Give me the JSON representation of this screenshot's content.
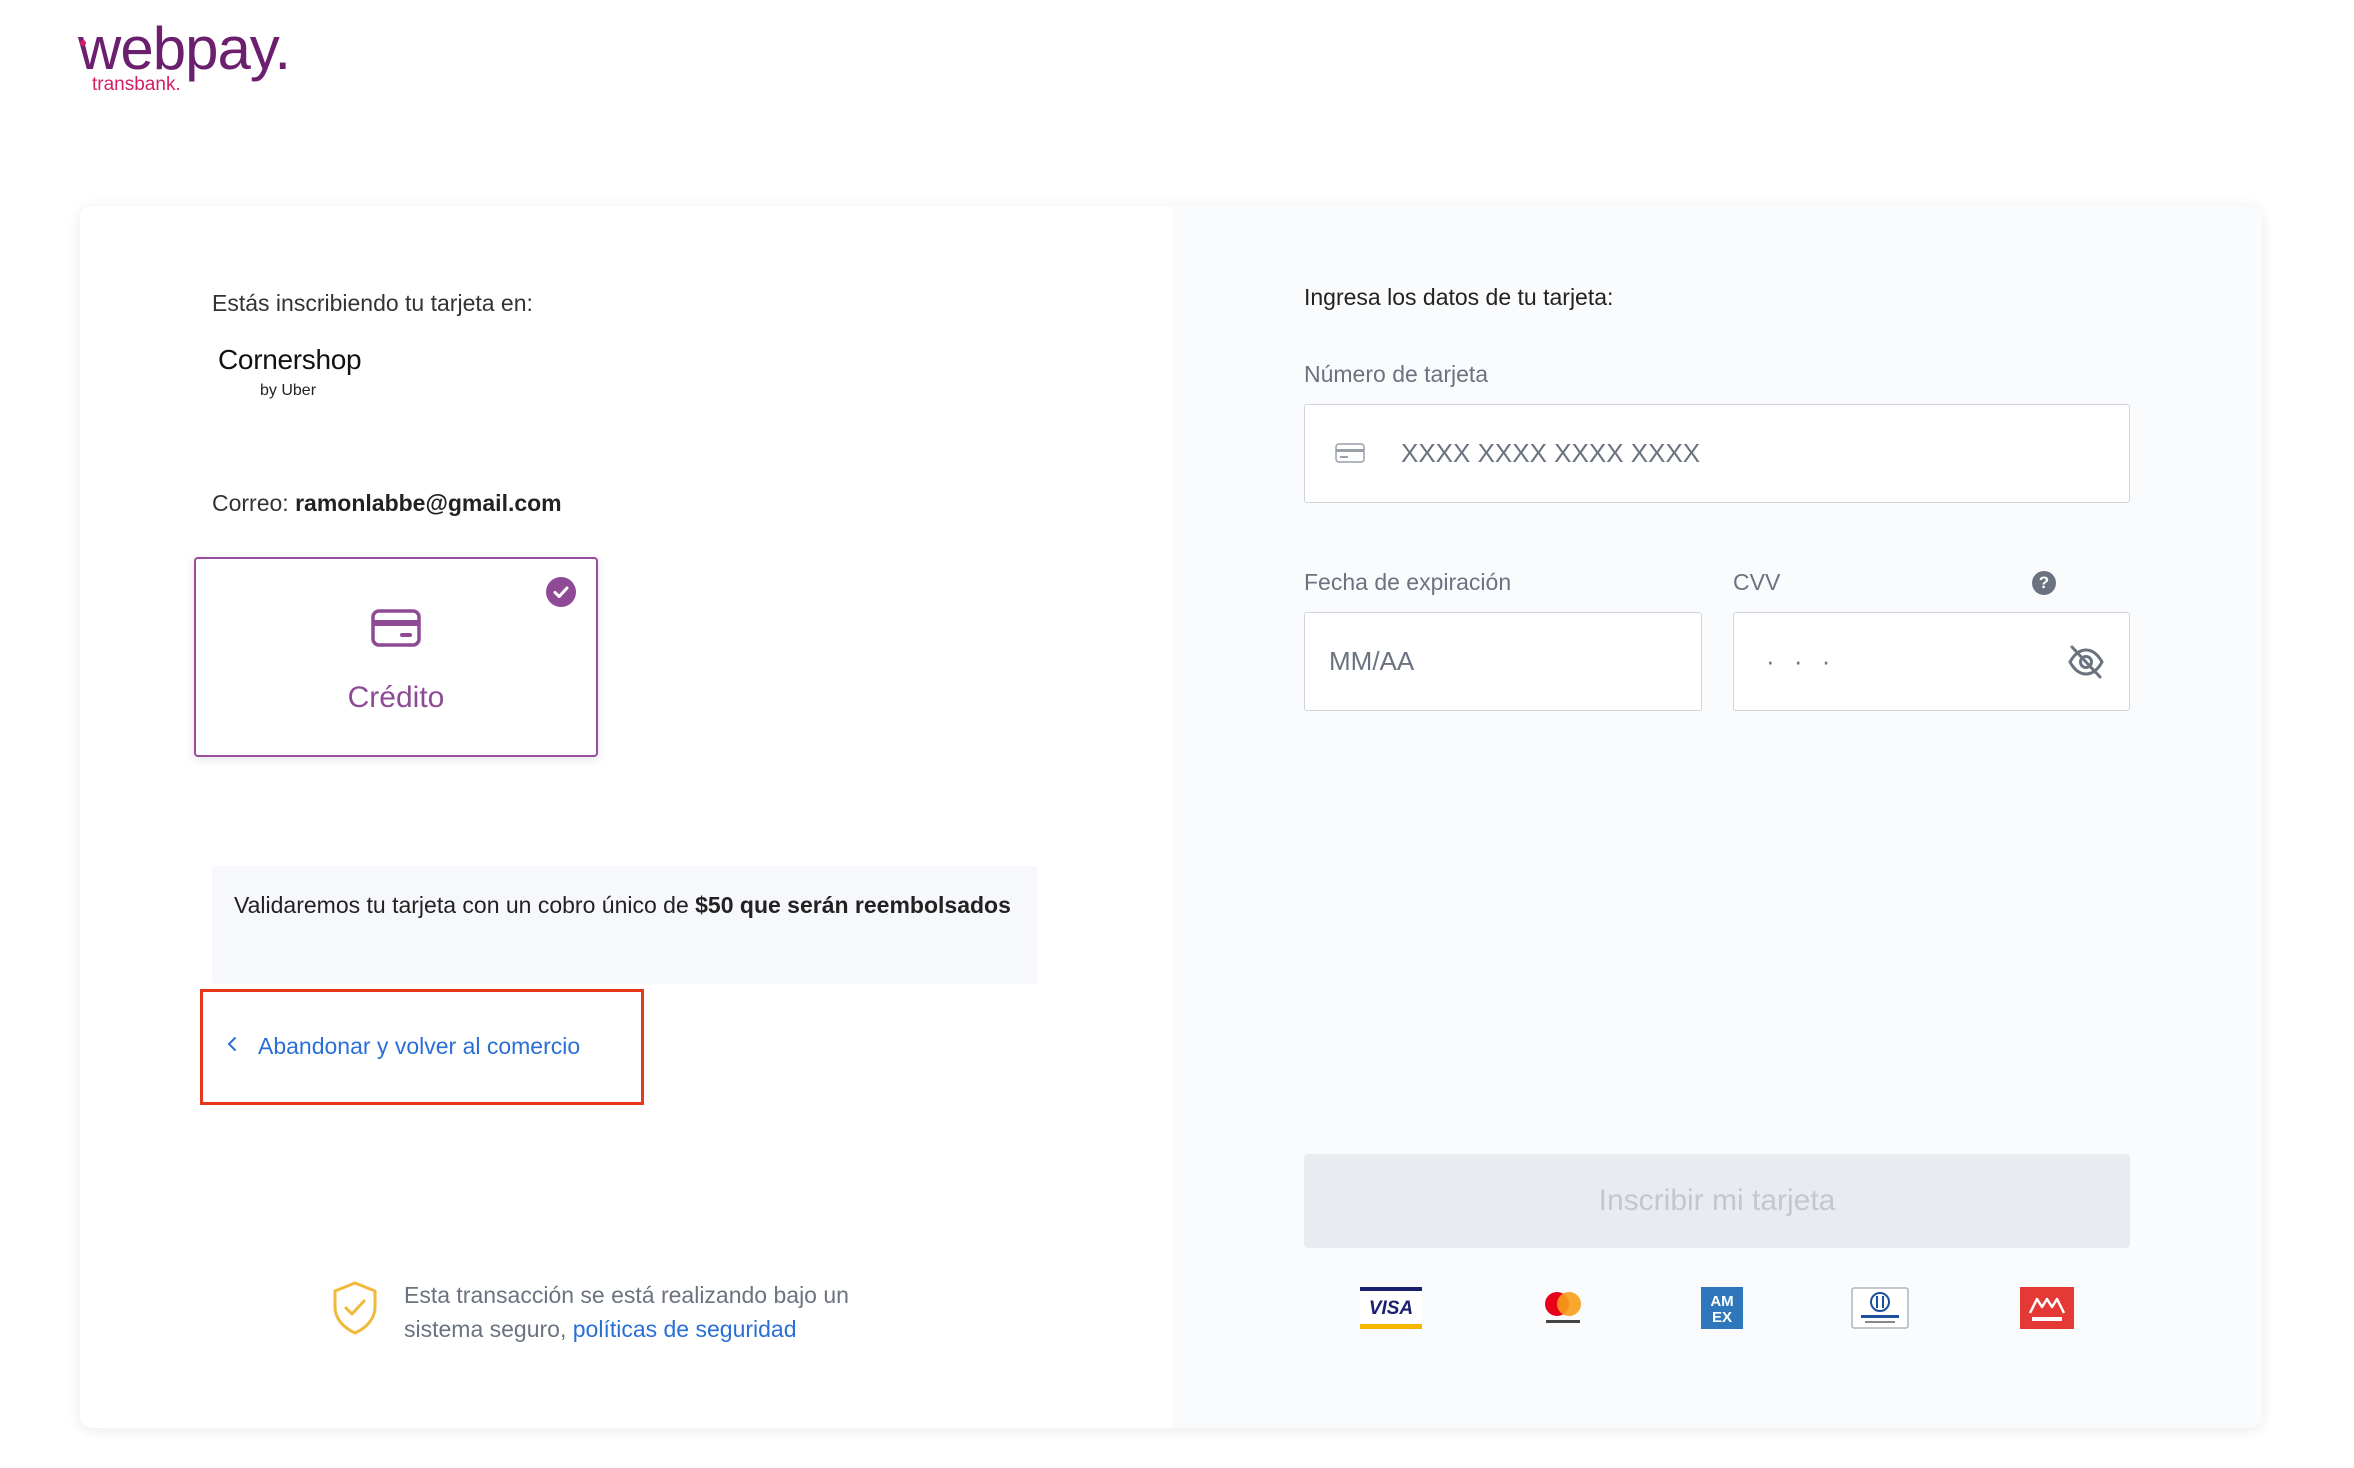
{
  "brand": {
    "logo_main": "webpay.",
    "logo_sub": "transbank."
  },
  "left": {
    "enrolling_label": "Estás inscribiendo tu tarjeta en:",
    "merchant_name": "Cornershop",
    "merchant_sub": "by Uber",
    "email_label": "Correo:",
    "email_value": "ramonlabbe@gmail.com",
    "card_type": {
      "label": "Crédito",
      "selected": true,
      "icon": "credit-card-icon"
    },
    "notice": {
      "prefix": "Validaremos tu tarjeta con un cobro único de",
      "bold": "$50 que serán reembolsados"
    },
    "back_link": "Abandonar y volver al comercio",
    "secure": {
      "text": "Esta transacción se está realizando bajo un sistema seguro,",
      "link": "políticas de seguridad",
      "icon": "shield-check-icon"
    }
  },
  "right": {
    "title": "Ingresa los datos de tu tarjeta:",
    "card_number": {
      "label": "Número de tarjeta",
      "placeholder": "XXXX XXXX XXXX XXXX",
      "value": ""
    },
    "expiry": {
      "label": "Fecha de expiración",
      "placeholder": "MM/AA",
      "value": ""
    },
    "cvv": {
      "label": "CVV",
      "placeholder": "· · ·",
      "help": "?",
      "value": ""
    },
    "submit_label": "Inscribir mi tarjeta",
    "submit_enabled": false,
    "brands": [
      "VISA",
      "mastercard",
      "AMEX",
      "Diners Club International",
      "MAGNA"
    ]
  },
  "colors": {
    "brand_purple": "#6b1f6e",
    "brand_pink": "#d31f62",
    "accent_purple": "#8f4a96",
    "link_blue": "#2a6fd6",
    "highlight_red": "#e8361a"
  }
}
